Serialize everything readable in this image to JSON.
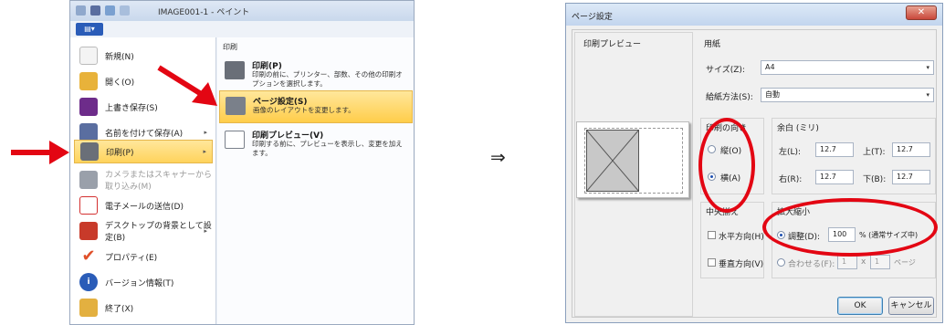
{
  "paint": {
    "title": "IMAGE001-1 - ペイント",
    "file_button": "▤▾",
    "menu_items": [
      {
        "label": "新規(N)",
        "icon": "new-document-icon",
        "color": "#f4f4f4"
      },
      {
        "label": "開く(O)",
        "icon": "open-folder-icon",
        "color": "#e8b23a"
      },
      {
        "label": "上書き保存(S)",
        "icon": "save-disk-icon",
        "color": "#6d2c8a"
      },
      {
        "label": "名前を付けて保存(A)",
        "icon": "save-as-icon",
        "color": "#5a6ea0",
        "arrow": "▸"
      },
      {
        "label": "印刷(P)",
        "icon": "printer-icon",
        "color": "#6a6f78",
        "arrow": "▸"
      },
      {
        "label": "カメラまたはスキャナーから取り込み(M)",
        "icon": "scanner-icon",
        "color": "#9aa0aa"
      },
      {
        "label": "電子メールの送信(D)",
        "icon": "email-icon",
        "color": "#d43030"
      },
      {
        "label": "デスクトップの背景として設定(B)",
        "icon": "desktop-icon",
        "color": "#c83a2a",
        "arrow": "▸"
      },
      {
        "label": "プロパティ(E)",
        "icon": "checkmark-icon",
        "color": "#e0502a"
      },
      {
        "label": "バージョン情報(T)",
        "icon": "info-icon",
        "color": "#2a5cb8"
      },
      {
        "label": "終了(X)",
        "icon": "exit-icon",
        "color": "#e3b040"
      }
    ],
    "submenu": {
      "header": "印刷",
      "items": [
        {
          "title": "印刷(P)",
          "desc": "印刷の前に、プリンター、部数、その他の印刷オプションを選択します。"
        },
        {
          "title": "ページ設定(S)",
          "desc": "画像のレイアウトを変更します。"
        },
        {
          "title": "印刷プレビュー(V)",
          "desc": "印刷する前に、プレビューを表示し、変更を加えます。"
        }
      ]
    }
  },
  "implies_symbol": "⇒",
  "dialog": {
    "title": "ページ設定",
    "close": "✕",
    "preview_label": "印刷プレビュー",
    "paper_group": "用紙",
    "size_label": "サイズ(Z):",
    "size_value": "A4",
    "feed_label": "給紙方法(S):",
    "feed_value": "自動",
    "orientation_group": "印刷の向き",
    "portrait_label": "縦(O)",
    "landscape_label": "横(A)",
    "margins_group": "余白 (ミリ)",
    "left_label": "左(L):",
    "left_value": "12.7",
    "top_label": "上(T):",
    "top_value": "12.7",
    "right_label": "右(R):",
    "right_value": "12.7",
    "bottom_label": "下(B):",
    "bottom_value": "12.7",
    "center_group": "中央揃え",
    "horizontal_label": "水平方向(H)",
    "vertical_label": "垂直方向(V)",
    "scale_group": "拡大縮小",
    "adjust_label": "調整(D):",
    "adjust_value": "100",
    "adjust_suffix": "% (通常サイズ中)",
    "fit_label": "合わせる(F):",
    "fit_x": "1",
    "fit_sep": "x",
    "fit_y": "1",
    "fit_suffix": "ページ",
    "ok_label": "OK",
    "cancel_label": "キャンセル",
    "dropdown_glyph": "▾"
  },
  "colors": {
    "annotation_red": "#e30613",
    "highlight": "#ffd35c"
  }
}
